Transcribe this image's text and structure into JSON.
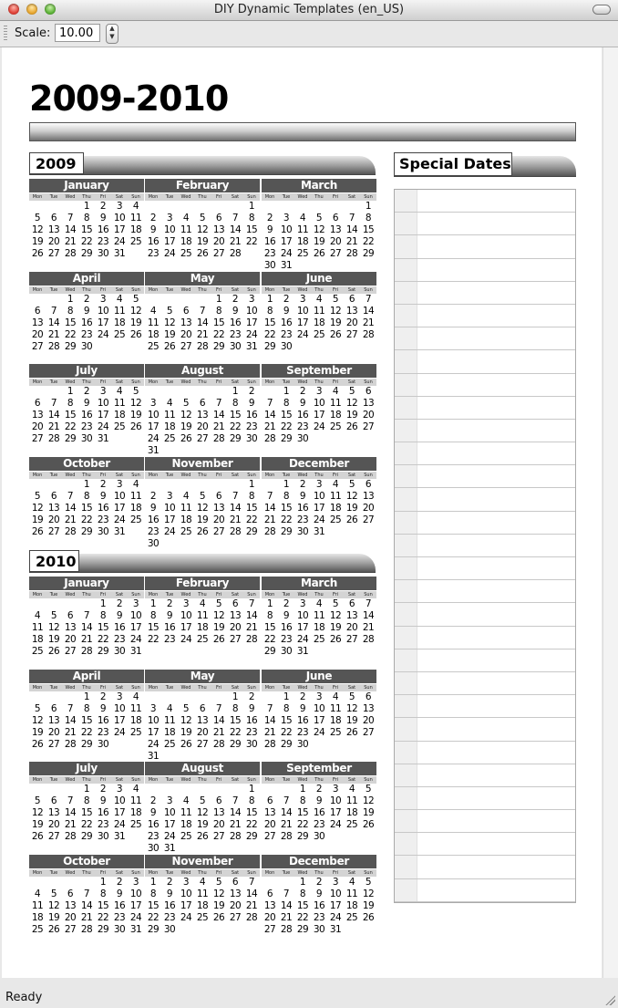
{
  "window": {
    "title": "DIY Dynamic Templates (en_US)"
  },
  "toolbar": {
    "scale_label": "Scale:",
    "scale_value": "10.00"
  },
  "status": "Ready",
  "document": {
    "title": "2009-2010"
  },
  "special": {
    "title": "Special Dates",
    "rows": 31
  },
  "weekdays": [
    "Mon",
    "Tue",
    "Wed",
    "Thu",
    "Fri",
    "Sat",
    "Sun"
  ],
  "years": [
    {
      "label": "2009",
      "months": [
        {
          "name": "January",
          "offset": 3,
          "days": 31
        },
        {
          "name": "February",
          "offset": 6,
          "days": 28
        },
        {
          "name": "March",
          "offset": 6,
          "days": 31
        },
        {
          "name": "April",
          "offset": 2,
          "days": 30
        },
        {
          "name": "May",
          "offset": 4,
          "days": 31
        },
        {
          "name": "June",
          "offset": 0,
          "days": 30
        },
        {
          "name": "July",
          "offset": 2,
          "days": 31
        },
        {
          "name": "August",
          "offset": 5,
          "days": 31
        },
        {
          "name": "September",
          "offset": 1,
          "days": 30
        },
        {
          "name": "October",
          "offset": 3,
          "days": 31
        },
        {
          "name": "November",
          "offset": 6,
          "days": 30
        },
        {
          "name": "December",
          "offset": 1,
          "days": 31
        }
      ]
    },
    {
      "label": "2010",
      "months": [
        {
          "name": "January",
          "offset": 4,
          "days": 31
        },
        {
          "name": "February",
          "offset": 0,
          "days": 28
        },
        {
          "name": "March",
          "offset": 0,
          "days": 31
        },
        {
          "name": "April",
          "offset": 3,
          "days": 30
        },
        {
          "name": "May",
          "offset": 5,
          "days": 31
        },
        {
          "name": "June",
          "offset": 1,
          "days": 30
        },
        {
          "name": "July",
          "offset": 3,
          "days": 31
        },
        {
          "name": "August",
          "offset": 6,
          "days": 31
        },
        {
          "name": "September",
          "offset": 2,
          "days": 30
        },
        {
          "name": "October",
          "offset": 4,
          "days": 31
        },
        {
          "name": "November",
          "offset": 0,
          "days": 30
        },
        {
          "name": "December",
          "offset": 2,
          "days": 31
        }
      ]
    }
  ]
}
